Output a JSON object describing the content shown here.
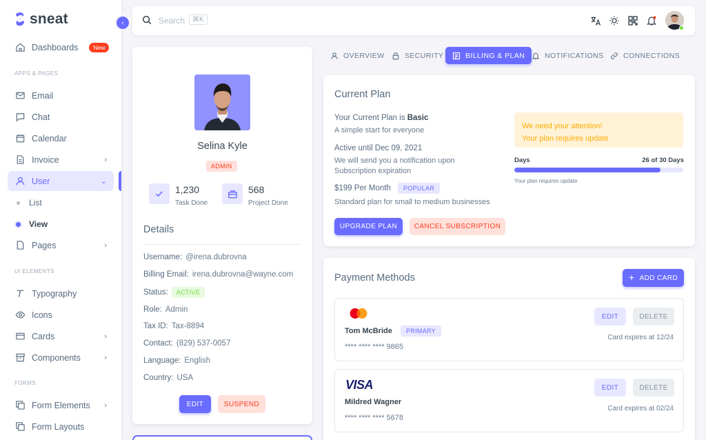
{
  "brand": {
    "name": "sneat"
  },
  "sidebar": {
    "dashboards": {
      "label": "Dashboards",
      "badge": "New"
    },
    "section_apps": "APPS & PAGES",
    "email": "Email",
    "chat": "Chat",
    "calendar": "Calendar",
    "invoice": "Invoice",
    "user": "User",
    "user_sub": [
      "List",
      "View"
    ],
    "pages": "Pages",
    "section_ui": "UI ELEMENTS",
    "typography": "Typography",
    "icons": "Icons",
    "cards": "Cards",
    "components": "Components",
    "section_forms": "FORMS",
    "form_elements": "Form Elements",
    "form_layouts": "Form Layouts"
  },
  "navbar": {
    "search_placeholder": "Search",
    "shortcut": "⌘K"
  },
  "profile": {
    "name": "Selina Kyle",
    "role": "ADMIN",
    "stats": [
      {
        "value": "1,230",
        "label": "Task Done"
      },
      {
        "value": "568",
        "label": "Project Done"
      }
    ],
    "details_title": "Details",
    "details": [
      {
        "label": "Username:",
        "value": "@irena.dubrovna"
      },
      {
        "label": "Billing Email:",
        "value": "irena.dubrovna@wayne.com"
      },
      {
        "label": "Status:",
        "value": "ACTIVE"
      },
      {
        "label": "Role:",
        "value": "Admin"
      },
      {
        "label": "Tax ID:",
        "value": "Tax-8894"
      },
      {
        "label": "Contact:",
        "value": "(829) 537-0057"
      },
      {
        "label": "Language:",
        "value": "English"
      },
      {
        "label": "Country:",
        "value": "USA"
      }
    ],
    "edit_label": "EDIT",
    "suspend_label": "SUSPEND"
  },
  "tabs": [
    "OVERVIEW",
    "SECURITY",
    "BILLING & PLAN",
    "NOTIFICATIONS",
    "CONNECTIONS"
  ],
  "plan": {
    "title": "Current Plan",
    "current_prefix": "Your Current Plan is ",
    "current_plan": "Basic",
    "current_desc": "A simple start for everyone",
    "active_until": "Active until Dec 09, 2021",
    "active_desc": "We will send you a notification upon Subscription expiration",
    "price": "$199 Per Month",
    "popular": "POPULAR",
    "price_desc": "Standard plan for small to medium businesses",
    "upgrade_label": "UPGRADE PLAN",
    "cancel_label": "CANCEL SUBSCRIPTION",
    "alert_title": "We need your attention!",
    "alert_text": "Your plan requires update",
    "days_label": "Days",
    "days_value": "26 of 30 Days",
    "days_progress": 0.8667,
    "progress_note": "Your plan requires update"
  },
  "payment": {
    "title": "Payment Methods",
    "add_label": "ADD CARD",
    "cards": [
      {
        "brand": "mastercard",
        "name": "Tom McBride",
        "badge": "PRIMARY",
        "number": "**** **** **** 9865",
        "expires": "Card expires at 12/24",
        "edit": "EDIT",
        "delete": "DELETE"
      },
      {
        "brand": "VISA",
        "name": "Mildred Wagner",
        "number": "**** **** **** 5678",
        "expires": "Card expires at 02/24",
        "edit": "EDIT",
        "delete": "DELETE"
      }
    ]
  },
  "colors": {
    "primary": "#696cff",
    "danger": "#ff3e1d",
    "success": "#71dd37",
    "warning": "#ffab00"
  }
}
